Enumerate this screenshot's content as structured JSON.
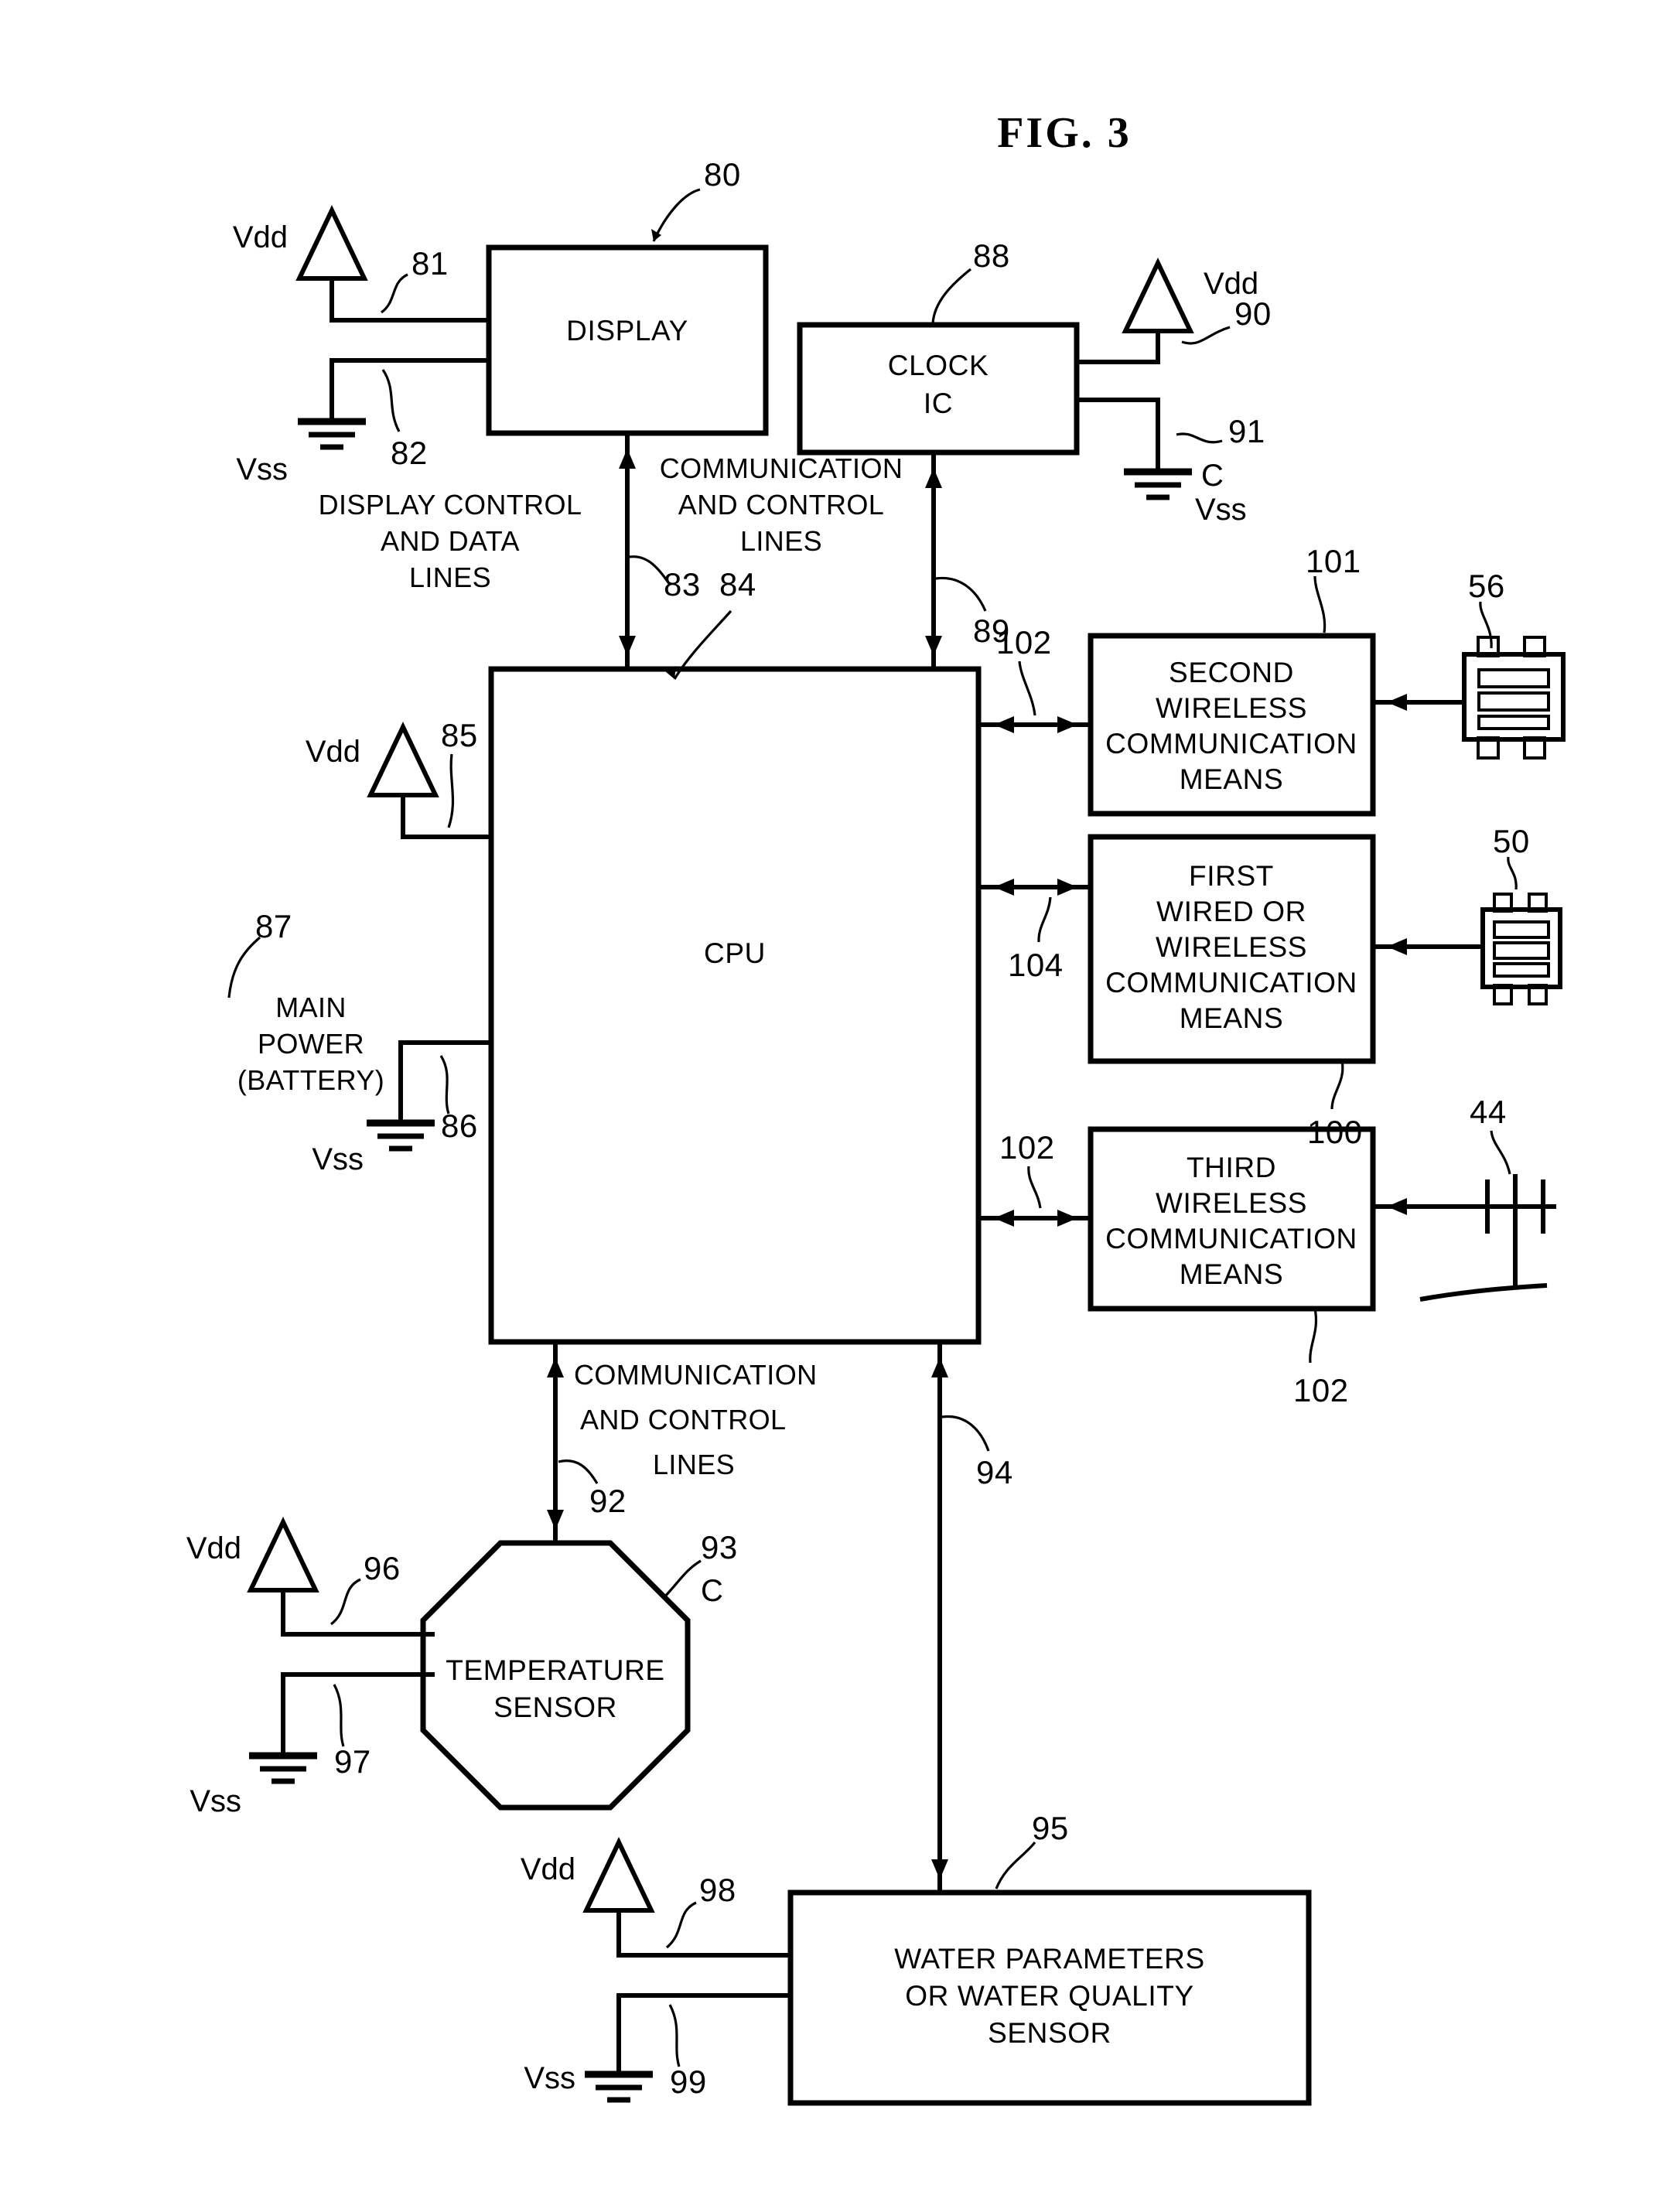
{
  "figure": {
    "title": "FIG. 3"
  },
  "blocks": {
    "display": {
      "label": "DISPLAY",
      "ref": "80"
    },
    "clock": {
      "line1": "CLOCK",
      "line2": "IC",
      "ref": "88"
    },
    "cpu": {
      "label": "CPU"
    },
    "second_wireless": {
      "line1": "SECOND",
      "line2": "WIRELESS",
      "line3": "COMMUNICATION",
      "line4": "MEANS",
      "ref": "101"
    },
    "first_wired_wireless": {
      "line1": "FIRST",
      "line2": "WIRED OR",
      "line3": "WIRELESS",
      "line4": "COMMUNICATION",
      "line5": "MEANS",
      "ref": "100"
    },
    "third_wireless": {
      "line1": "THIRD",
      "line2": "WIRELESS",
      "line3": "COMMUNICATION",
      "line4": "MEANS",
      "ref": "102"
    },
    "temperature_sensor": {
      "line1": "TEMPERATURE",
      "line2": "SENSOR",
      "ref": "93",
      "ref_note": "C"
    },
    "water_sensor": {
      "line1": "WATER PARAMETERS",
      "line2": "OR WATER QUALITY",
      "line3": "SENSOR",
      "ref": "95"
    }
  },
  "notes": {
    "display_control": {
      "line1": "DISPLAY CONTROL",
      "line2": "AND DATA",
      "line3": "LINES",
      "ref": "83"
    },
    "comm_control_top": {
      "line1": "COMMUNICATION",
      "line2": "AND CONTROL",
      "line3": "LINES",
      "ref": "84"
    },
    "comm_control_bottom": {
      "line1": "COMMUNICATION",
      "line2": "AND  CONTROL",
      "line3": "LINES",
      "ref_left": "92",
      "ref_right": "94"
    },
    "main_power": {
      "line1": "MAIN",
      "line2": "POWER",
      "line3": "(BATTERY)",
      "ref": "87"
    }
  },
  "power_rails": {
    "display_vdd": {
      "label": "Vdd",
      "ref": "81"
    },
    "display_vss": {
      "label": "Vss",
      "ref": "82"
    },
    "clock_vdd": {
      "label": "Vdd",
      "ref": "90"
    },
    "clock_vss": {
      "label": "Vss",
      "ref": "91",
      "note": "C"
    },
    "cpu_vdd": {
      "label": "Vdd",
      "ref": "85"
    },
    "cpu_vss": {
      "label": "Vss",
      "ref": "86"
    },
    "temp_vdd": {
      "label": "Vdd",
      "ref": "96"
    },
    "temp_vss": {
      "label": "Vss",
      "ref": "97"
    },
    "water_vdd": {
      "label": "Vdd",
      "ref": "98"
    },
    "water_vss": {
      "label": "Vss",
      "ref": "99"
    }
  },
  "connections": {
    "clock_to_cpu_ref": "89",
    "second_wireless_bus_ref": "102",
    "first_wireless_bus_ref": "104",
    "third_wireless_bus_ref": "102"
  },
  "devices": {
    "device_56": {
      "ref": "56",
      "kind": "module-icon"
    },
    "device_50": {
      "ref": "50",
      "kind": "module-icon"
    },
    "device_44": {
      "ref": "44",
      "kind": "antenna-icon"
    }
  }
}
